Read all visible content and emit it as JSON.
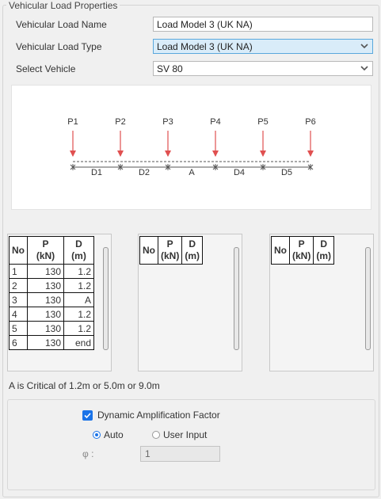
{
  "group": {
    "title": "Vehicular Load Properties"
  },
  "fields": {
    "name_label": "Vehicular Load Name",
    "name_value": "Load Model 3 (UK NA)",
    "type_label": "Vehicular Load Type",
    "type_value": "Load Model 3 (UK NA)",
    "vehicle_label": "Select Vehicle",
    "vehicle_value": "SV 80"
  },
  "diagram": {
    "loads": [
      "P1",
      "P2",
      "P3",
      "P4",
      "P5",
      "P6"
    ],
    "spacings": [
      "D1",
      "D2",
      "A",
      "D4",
      "D5"
    ],
    "load_color": "#e05050"
  },
  "tables": {
    "headers": {
      "no": "No",
      "p": "P",
      "p_unit": "(kN)",
      "d": "D",
      "d_unit": "(m)"
    },
    "rows": [
      {
        "no": "1",
        "p": "130",
        "d": "1.2"
      },
      {
        "no": "2",
        "p": "130",
        "d": "1.2"
      },
      {
        "no": "3",
        "p": "130",
        "d": "A"
      },
      {
        "no": "4",
        "p": "130",
        "d": "1.2"
      },
      {
        "no": "5",
        "p": "130",
        "d": "1.2"
      },
      {
        "no": "6",
        "p": "130",
        "d": "end"
      }
    ]
  },
  "note": "A is Critical of 1.2m or 5.0m or 9.0m",
  "daf": {
    "checkbox_label": "Dynamic Amplification Factor",
    "checked": true,
    "radio_auto": "Auto",
    "radio_user": "User Input",
    "selected": "Auto",
    "phi_label": "φ :",
    "phi_value": "1",
    "accent": "#1a73e8"
  }
}
